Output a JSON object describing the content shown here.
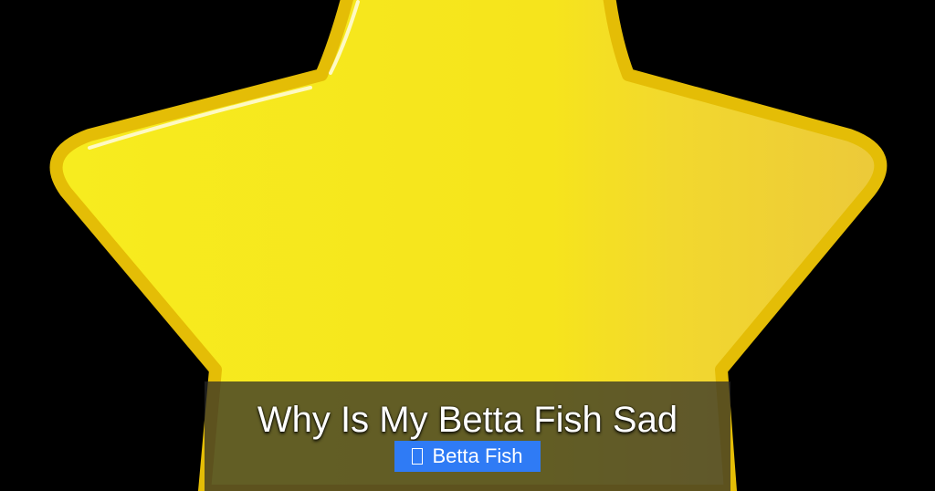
{
  "thumbnail": {
    "title": "Why Is My Betta Fish Sad",
    "category": {
      "label": "Betta Fish",
      "icon": "tag-icon",
      "color": "#2f7bf5"
    },
    "background_color": "#000000",
    "star_color": "#f5e417",
    "star_outline_color": "#e0b800"
  }
}
